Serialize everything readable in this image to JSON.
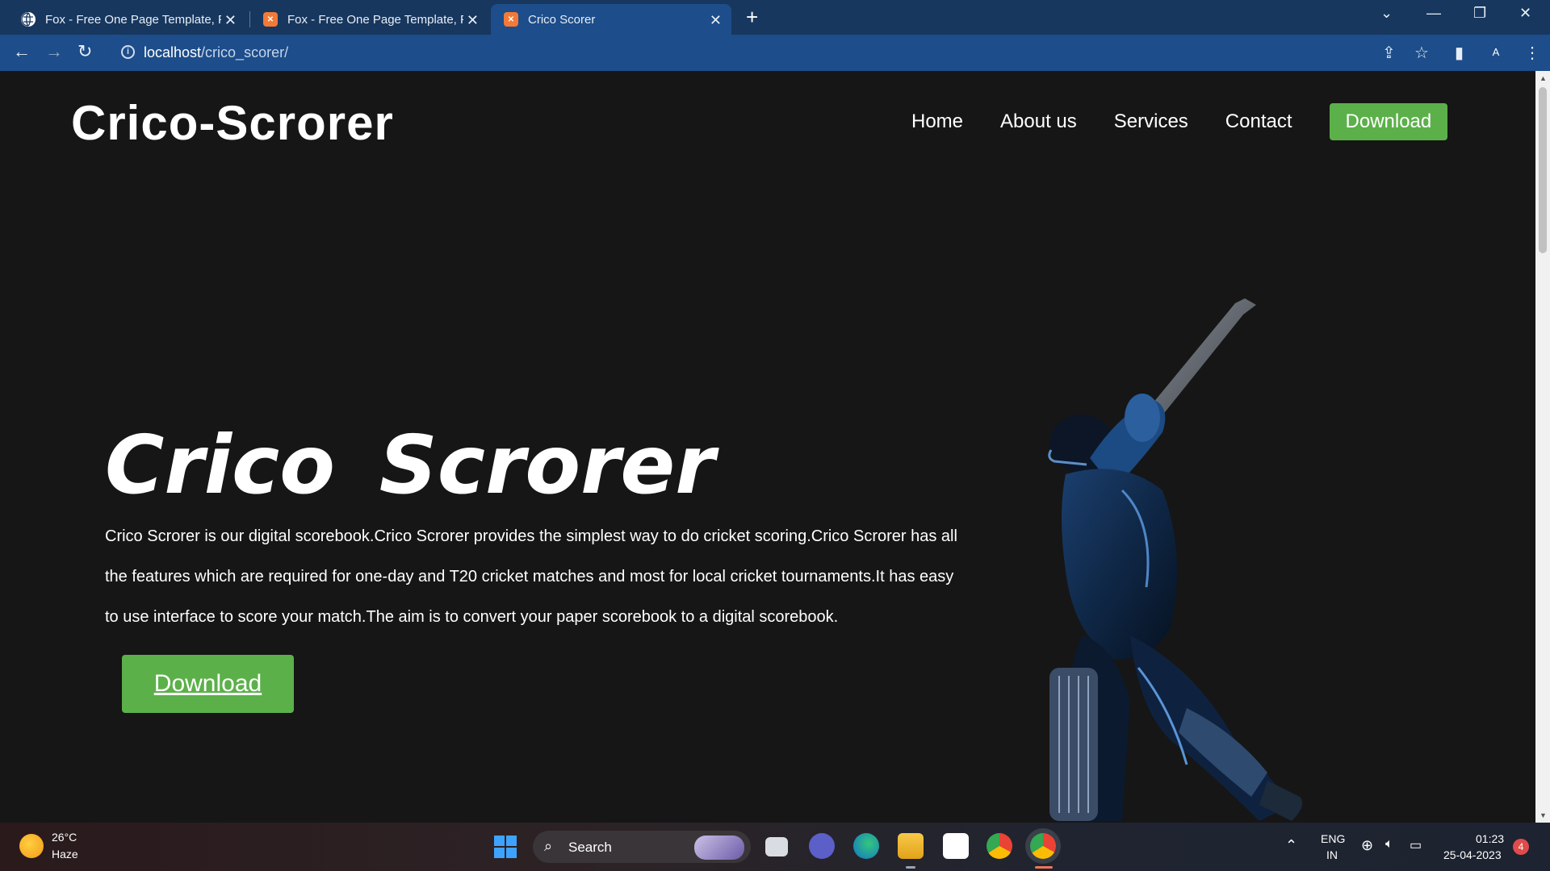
{
  "browser": {
    "tabs": [
      {
        "title": "Fox - Free One Page Template, Fr",
        "favicon": "globe-icon"
      },
      {
        "title": "Fox - Free One Page Template, Fr",
        "favicon": "xampp-icon"
      },
      {
        "title": "Crico Scorer",
        "favicon": "xampp-icon",
        "active": true
      }
    ],
    "url_host": "localhost",
    "url_path": "/crico_scorer/",
    "profile_initial": "A"
  },
  "page": {
    "brand": "Crico-Scrorer",
    "nav": {
      "home": "Home",
      "about": "About us",
      "services": "Services",
      "contact": "Contact",
      "download": "Download"
    },
    "hero": {
      "title": "Crico Scrorer",
      "description": "Crico Scrorer is our digital scorebook.Crico Scrorer provides the simplest way to do cricket scoring.Crico Scrorer has all the features which are required for one-day and T20 cricket matches and most for local cricket tournaments.It has easy to use interface to score your match.The aim is to convert your paper scorebook to a digital scorebook.",
      "download_label": "Download"
    },
    "accent_color": "#5cb04a"
  },
  "taskbar": {
    "weather_temp": "26°C",
    "weather_condition": "Haze",
    "search_label": "Search",
    "lang_top": "ENG",
    "lang_bottom": "IN",
    "time": "01:23",
    "date": "25-04-2023",
    "notification_count": "4"
  }
}
